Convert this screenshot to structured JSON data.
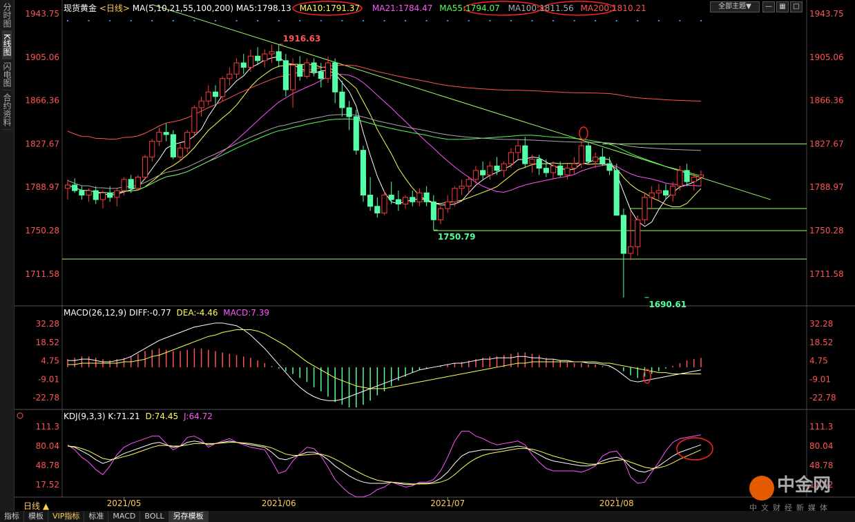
{
  "app": {
    "side_tabs": [
      "分时图",
      "K线图",
      "闪电图",
      "合约资料"
    ],
    "active_side_tab": 1,
    "bottom_tabs": [
      "指标",
      "模板",
      "VIP指标",
      "标准",
      "MACD",
      "BOLL",
      "另存模板"
    ],
    "active_bottom_tab": 6,
    "theme_button": "全部主题▼",
    "period_label": "日线 ▲"
  },
  "watermark": {
    "brand": "中金网",
    "slogan": "中文财经新媒体"
  },
  "header": {
    "symbol": "现货黄金",
    "period": "<日线>",
    "ma_params": "MA(5,10,21,55,100,200)",
    "ma_values": [
      {
        "label": "MA5:1798.13",
        "color": "#ffffff"
      },
      {
        "label": "MA10:1791.37",
        "color": "#ffff55"
      },
      {
        "label": "MA21:1784.47",
        "color": "#ff55ff"
      },
      {
        "label": "MA55:1794.07",
        "color": "#55ff55"
      },
      {
        "label": "MA100:1811.56",
        "color": "#aaaaaa"
      },
      {
        "label": "MA200:1810.21",
        "color": "#ff5555"
      }
    ]
  },
  "chart_data": [
    {
      "type": "candlestick",
      "name": "现货黄金 日线",
      "y_ticks": [
        1943.75,
        1905.06,
        1866.36,
        1827.67,
        1788.97,
        1750.28,
        1711.58
      ],
      "ylim": [
        1685,
        1945
      ],
      "x_ticks": [
        "2021/05",
        "2021/06",
        "2021/07",
        "2021/08"
      ],
      "x_tick_index": [
        8,
        30,
        54,
        78
      ],
      "annotations": [
        {
          "text": "1916.63",
          "index": 30,
          "value": 1916.63,
          "color": "#ff5555"
        },
        {
          "text": "1750.79",
          "index": 52,
          "value": 1750.79,
          "color": "#55ff99"
        },
        {
          "text": "1690.61",
          "index": 82,
          "value": 1690.61,
          "color": "#55ff99"
        }
      ],
      "candles": [
        [
          1788,
          1796,
          1778,
          1791
        ],
        [
          1791,
          1797,
          1784,
          1786
        ],
        [
          1786,
          1790,
          1778,
          1782
        ],
        [
          1782,
          1788,
          1776,
          1786
        ],
        [
          1786,
          1790,
          1774,
          1778
        ],
        [
          1778,
          1786,
          1770,
          1784
        ],
        [
          1784,
          1790,
          1776,
          1780
        ],
        [
          1780,
          1788,
          1772,
          1786
        ],
        [
          1786,
          1798,
          1782,
          1796
        ],
        [
          1796,
          1800,
          1784,
          1788
        ],
        [
          1788,
          1800,
          1786,
          1798
        ],
        [
          1798,
          1818,
          1796,
          1816
        ],
        [
          1816,
          1832,
          1812,
          1830
        ],
        [
          1830,
          1842,
          1826,
          1838
        ],
        [
          1838,
          1846,
          1830,
          1836
        ],
        [
          1836,
          1840,
          1814,
          1816
        ],
        [
          1816,
          1828,
          1812,
          1824
        ],
        [
          1824,
          1840,
          1820,
          1838
        ],
        [
          1838,
          1862,
          1834,
          1860
        ],
        [
          1860,
          1870,
          1852,
          1866
        ],
        [
          1866,
          1880,
          1862,
          1874
        ],
        [
          1874,
          1880,
          1862,
          1870
        ],
        [
          1870,
          1888,
          1866,
          1886
        ],
        [
          1886,
          1896,
          1880,
          1890
        ],
        [
          1890,
          1904,
          1886,
          1900
        ],
        [
          1900,
          1908,
          1890,
          1896
        ],
        [
          1896,
          1912,
          1892,
          1906
        ],
        [
          1906,
          1914,
          1898,
          1902
        ],
        [
          1902,
          1912,
          1896,
          1908
        ],
        [
          1908,
          1916,
          1900,
          1910
        ],
        [
          1910,
          1916.63,
          1896,
          1902
        ],
        [
          1902,
          1908,
          1870,
          1876
        ],
        [
          1876,
          1904,
          1860,
          1898
        ],
        [
          1898,
          1906,
          1884,
          1888
        ],
        [
          1888,
          1904,
          1886,
          1900
        ],
        [
          1900,
          1904,
          1888,
          1892
        ],
        [
          1892,
          1900,
          1878,
          1886
        ],
        [
          1886,
          1906,
          1882,
          1900
        ],
        [
          1900,
          1904,
          1864,
          1874
        ],
        [
          1874,
          1884,
          1852,
          1860
        ],
        [
          1860,
          1866,
          1840,
          1852
        ],
        [
          1852,
          1858,
          1818,
          1822
        ],
        [
          1822,
          1826,
          1776,
          1782
        ],
        [
          1782,
          1798,
          1768,
          1772
        ],
        [
          1772,
          1780,
          1762,
          1766
        ],
        [
          1766,
          1786,
          1764,
          1782
        ],
        [
          1782,
          1794,
          1774,
          1778
        ],
        [
          1778,
          1786,
          1768,
          1774
        ],
        [
          1774,
          1782,
          1770,
          1780
        ],
        [
          1780,
          1786,
          1772,
          1776
        ],
        [
          1776,
          1788,
          1772,
          1784
        ],
        [
          1784,
          1790,
          1772,
          1776
        ],
        [
          1776,
          1782,
          1750.79,
          1760
        ],
        [
          1760,
          1772,
          1756,
          1770
        ],
        [
          1770,
          1782,
          1766,
          1776
        ],
        [
          1776,
          1790,
          1772,
          1788
        ],
        [
          1788,
          1796,
          1782,
          1790
        ],
        [
          1790,
          1798,
          1784,
          1796
        ],
        [
          1796,
          1808,
          1792,
          1804
        ],
        [
          1804,
          1812,
          1796,
          1800
        ],
        [
          1800,
          1812,
          1796,
          1808
        ],
        [
          1808,
          1816,
          1800,
          1804
        ],
        [
          1804,
          1812,
          1798,
          1810
        ],
        [
          1810,
          1824,
          1806,
          1820
        ],
        [
          1820,
          1832,
          1814,
          1826
        ],
        [
          1826,
          1834,
          1806,
          1810
        ],
        [
          1810,
          1818,
          1802,
          1814
        ],
        [
          1814,
          1818,
          1800,
          1806
        ],
        [
          1806,
          1814,
          1798,
          1802
        ],
        [
          1802,
          1812,
          1796,
          1808
        ],
        [
          1808,
          1812,
          1798,
          1800
        ],
        [
          1800,
          1810,
          1796,
          1806
        ],
        [
          1806,
          1816,
          1800,
          1810
        ],
        [
          1810,
          1830,
          1806,
          1826
        ],
        [
          1826,
          1830,
          1810,
          1812
        ],
        [
          1812,
          1820,
          1806,
          1816
        ],
        [
          1816,
          1824,
          1808,
          1810
        ],
        [
          1810,
          1816,
          1800,
          1804
        ],
        [
          1804,
          1810,
          1770,
          1764
        ],
        [
          1764,
          1770,
          1690.61,
          1730
        ],
        [
          1730,
          1768,
          1724,
          1736
        ],
        [
          1736,
          1764,
          1728,
          1760
        ],
        [
          1760,
          1784,
          1756,
          1780
        ],
        [
          1780,
          1790,
          1770,
          1784
        ],
        [
          1784,
          1792,
          1778,
          1786
        ],
        [
          1786,
          1792,
          1778,
          1782
        ],
        [
          1782,
          1794,
          1776,
          1790
        ],
        [
          1790,
          1808,
          1786,
          1804
        ],
        [
          1804,
          1810,
          1790,
          1794
        ],
        [
          1794,
          1802,
          1786,
          1798
        ],
        [
          1798,
          1804,
          1790,
          1800
        ]
      ],
      "ma_lines": [
        {
          "name": "MA5",
          "color": "#ffffff"
        },
        {
          "name": "MA10",
          "color": "#ffff55"
        },
        {
          "name": "MA21",
          "color": "#ff55ff"
        },
        {
          "name": "MA55",
          "color": "#55ff55"
        },
        {
          "name": "MA100",
          "color": "#aaaaaa"
        },
        {
          "name": "MA200",
          "color": "#ff5555"
        }
      ],
      "horizontal_lines": [
        1827.67,
        1770,
        1750.28,
        1725
      ],
      "trend_line": {
        "from": {
          "index": 12,
          "value": 1952
        },
        "to": {
          "index": 94,
          "value": 1778
        }
      },
      "trend_line_color": "#99ff66"
    },
    {
      "type": "bar+line",
      "name": "MACD",
      "header": [
        {
          "label": "MACD(26,12,9)",
          "color": "#ffffff"
        },
        {
          "label": "DIFF:-0.77",
          "color": "#ffffff"
        },
        {
          "label": "DEA:-4.46",
          "color": "#ffff55"
        },
        {
          "label": "MACD:7.39",
          "color": "#ff55ff"
        }
      ],
      "y_ticks": [
        32.28,
        18.52,
        4.75,
        -9.01,
        -22.78
      ],
      "ylim": [
        -30,
        36
      ],
      "histogram": [
        6,
        7,
        8,
        8,
        7,
        6,
        5,
        6,
        7,
        8,
        10,
        12,
        13,
        14,
        13,
        12,
        12,
        13,
        14,
        14,
        13,
        12,
        11,
        10,
        9,
        8,
        7,
        5,
        3,
        1,
        -1,
        -3,
        -5,
        -8,
        -11,
        -15,
        -18,
        -22,
        -26,
        -28,
        -30,
        -30,
        -28,
        -25,
        -21,
        -18,
        -14,
        -10,
        -7,
        -4,
        -2,
        -1,
        0,
        1,
        2,
        3,
        4,
        5,
        6,
        7,
        8,
        8,
        9,
        10,
        11,
        11,
        10,
        9,
        7,
        6,
        5,
        4,
        3,
        3,
        2,
        2,
        1,
        1,
        0,
        -3,
        -6,
        -8,
        -7,
        -5,
        -3,
        -1,
        1,
        3,
        5,
        6,
        7,
        6,
        7,
        8
      ],
      "diff": [
        5,
        5,
        6,
        6,
        5,
        4,
        4,
        5,
        6,
        8,
        11,
        14,
        17,
        20,
        22,
        24,
        26,
        28,
        30,
        31,
        32,
        33,
        33,
        32,
        31,
        28,
        24,
        19,
        14,
        8,
        2,
        -4,
        -10,
        -15,
        -19,
        -22,
        -24,
        -25,
        -25,
        -24,
        -22,
        -20,
        -18,
        -16,
        -14,
        -12,
        -10,
        -8,
        -6,
        -4,
        -2,
        -1,
        0,
        1,
        2,
        3,
        3,
        4,
        5,
        6,
        6,
        7,
        7,
        7,
        8,
        8,
        7,
        7,
        6,
        6,
        5,
        5,
        4,
        4,
        3,
        3,
        2,
        1,
        -2,
        -6,
        -10,
        -11,
        -10,
        -9,
        -8,
        -7,
        -6,
        -5,
        -4,
        -3,
        -2,
        -1.5,
        -1,
        -0.77
      ],
      "dea": [
        2,
        2,
        3,
        3,
        3,
        3,
        3,
        3,
        4,
        4,
        5,
        6,
        8,
        9,
        11,
        13,
        15,
        17,
        19,
        21,
        23,
        24,
        26,
        27,
        28,
        28,
        28,
        27,
        25,
        22,
        19,
        16,
        12,
        8,
        4,
        1,
        -2,
        -5,
        -8,
        -10,
        -12,
        -14,
        -15,
        -16,
        -16,
        -16,
        -15,
        -14,
        -13,
        -12,
        -11,
        -10,
        -9,
        -8,
        -7,
        -6,
        -5,
        -4,
        -3,
        -2,
        -1,
        0,
        1,
        2,
        3,
        3,
        4,
        4,
        4,
        4,
        4,
        4,
        4,
        4,
        4,
        4,
        3,
        3,
        2,
        1,
        0,
        -1,
        -2,
        -3,
        -4,
        -4,
        -5,
        -5,
        -5,
        -5,
        -5,
        -4.8,
        -4.6,
        -4.46
      ],
      "pos_color": "#ff5555",
      "neg_color": "#55ff99"
    },
    {
      "type": "line",
      "name": "KDJ",
      "header": [
        {
          "label": "KDJ(9,3,3)",
          "color": "#ffffff"
        },
        {
          "label": "K:71.21",
          "color": "#ffffff"
        },
        {
          "label": "D:74.45",
          "color": "#ffff55"
        },
        {
          "label": "J:64.72",
          "color": "#ff55ff"
        }
      ],
      "y_ticks": [
        111.3,
        80.04,
        48.78,
        17.52
      ],
      "ylim": [
        0,
        120
      ],
      "k": [
        80,
        78,
        72,
        66,
        58,
        52,
        56,
        62,
        68,
        72,
        76,
        80,
        84,
        86,
        82,
        78,
        80,
        86,
        88,
        86,
        82,
        84,
        86,
        88,
        86,
        84,
        82,
        80,
        78,
        70,
        60,
        58,
        62,
        66,
        70,
        70,
        66,
        58,
        48,
        40,
        32,
        26,
        22,
        20,
        20,
        20,
        22,
        20,
        18,
        18,
        20,
        20,
        22,
        28,
        38,
        52,
        64,
        70,
        72,
        74,
        74,
        74,
        76,
        78,
        80,
        78,
        72,
        66,
        60,
        56,
        54,
        52,
        50,
        48,
        48,
        50,
        56,
        60,
        62,
        58,
        46,
        40,
        38,
        42,
        48,
        56,
        64,
        70,
        74,
        78,
        82,
        80,
        76,
        73,
        71.21
      ],
      "d": [
        80,
        79,
        76,
        72,
        66,
        60,
        58,
        60,
        63,
        66,
        70,
        74,
        78,
        81,
        81,
        80,
        80,
        82,
        84,
        84,
        84,
        84,
        85,
        86,
        86,
        85,
        84,
        82,
        80,
        77,
        72,
        67,
        65,
        65,
        66,
        67,
        67,
        64,
        59,
        53,
        46,
        40,
        34,
        29,
        25,
        23,
        22,
        21,
        20,
        19,
        19,
        19,
        20,
        22,
        26,
        34,
        44,
        53,
        60,
        65,
        68,
        70,
        72,
        74,
        76,
        76,
        75,
        72,
        68,
        64,
        61,
        58,
        55,
        53,
        51,
        51,
        52,
        55,
        57,
        58,
        54,
        50,
        46,
        44,
        45,
        48,
        53,
        59,
        64,
        69,
        74,
        77,
        77,
        75,
        74.45
      ],
      "j": [
        82,
        74,
        62,
        54,
        42,
        34,
        48,
        66,
        78,
        84,
        88,
        92,
        96,
        96,
        84,
        74,
        80,
        94,
        96,
        90,
        78,
        84,
        88,
        92,
        86,
        82,
        78,
        76,
        74,
        56,
        36,
        40,
        56,
        68,
        78,
        76,
        64,
        46,
        26,
        14,
        4,
        -2,
        -2,
        2,
        10,
        14,
        22,
        18,
        14,
        16,
        22,
        22,
        26,
        40,
        62,
        88,
        104,
        104,
        96,
        92,
        86,
        82,
        84,
        86,
        88,
        82,
        66,
        54,
        44,
        40,
        40,
        40,
        40,
        38,
        42,
        48,
        64,
        70,
        72,
        58,
        30,
        20,
        22,
        38,
        54,
        72,
        86,
        92,
        94,
        96,
        98,
        86,
        74,
        68,
        64.72
      ]
    }
  ]
}
